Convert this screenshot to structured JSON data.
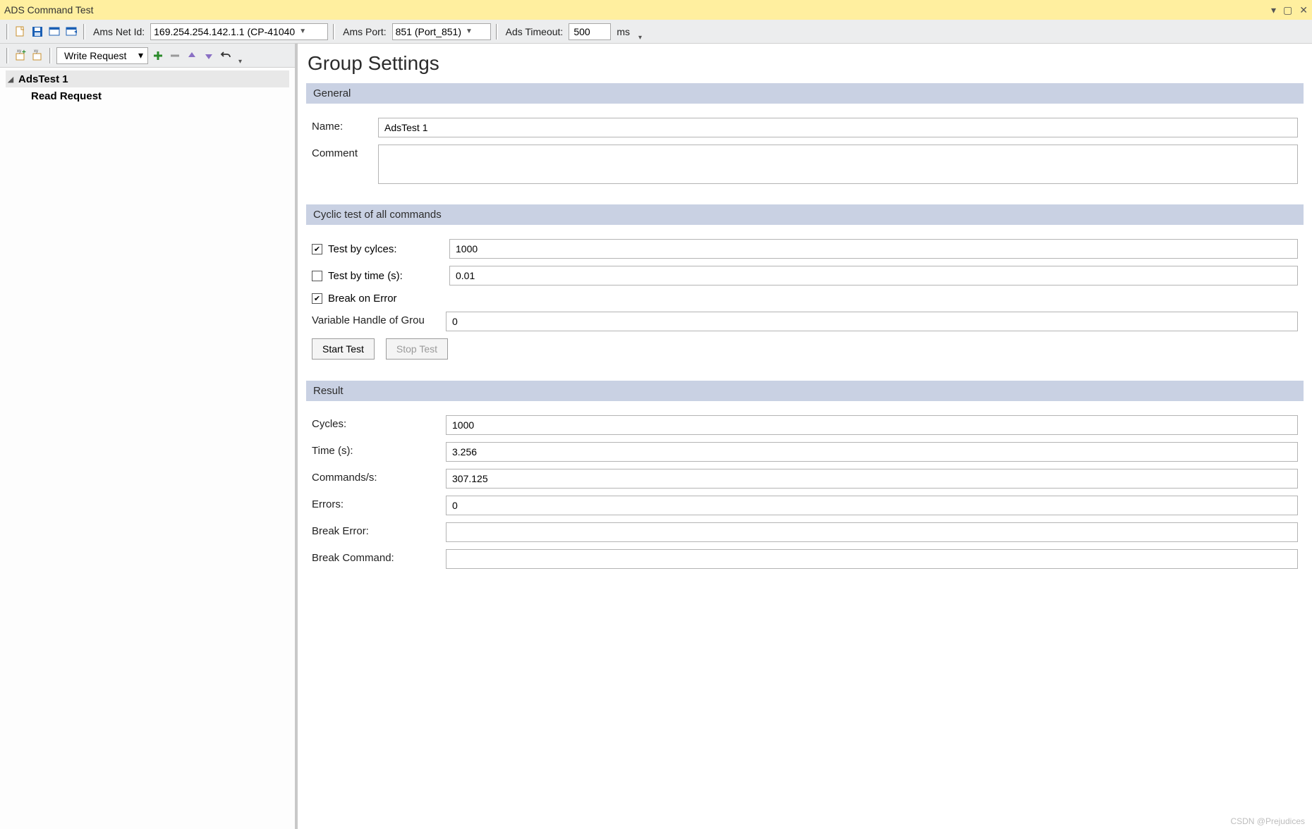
{
  "window": {
    "title": "ADS Command Test"
  },
  "toolbar1": {
    "ams_net_id_label": "Ams Net Id:",
    "ams_net_id_value": "169.254.254.142.1.1 (CP-41040",
    "ams_port_label": "Ams Port:",
    "ams_port_value": "851 (Port_851)",
    "ads_timeout_label": "Ads Timeout:",
    "ads_timeout_value": "500",
    "ads_timeout_unit": "ms"
  },
  "toolbar2": {
    "request_type": "Write Request"
  },
  "tree": {
    "root_label": "AdsTest 1",
    "child_label": "Read Request"
  },
  "page": {
    "title": "Group Settings"
  },
  "sections": {
    "general": {
      "header": "General",
      "name_label": "Name:",
      "name_value": "AdsTest 1",
      "comment_label": "Comment",
      "comment_value": ""
    },
    "cyclic": {
      "header": "Cyclic test of all commands",
      "test_by_cycles_label": "Test by cylces:",
      "test_by_cycles_checked": true,
      "test_by_cycles_value": "1000",
      "test_by_time_label": "Test by time (s):",
      "test_by_time_checked": false,
      "test_by_time_value": "0.01",
      "break_on_error_label": "Break on Error",
      "break_on_error_checked": true,
      "var_handle_label": "Variable Handle of Grou",
      "var_handle_value": "0",
      "start_test_label": "Start Test",
      "stop_test_label": "Stop Test"
    },
    "result": {
      "header": "Result",
      "cycles_label": "Cycles:",
      "cycles_value": "1000",
      "time_label": "Time (s):",
      "time_value": "3.256",
      "cps_label": "Commands/s:",
      "cps_value": "307.125",
      "errors_label": "Errors:",
      "errors_value": "0",
      "break_error_label": "Break Error:",
      "break_error_value": "",
      "break_command_label": "Break Command:",
      "break_command_value": ""
    }
  },
  "watermark": "CSDN @Prejudices"
}
